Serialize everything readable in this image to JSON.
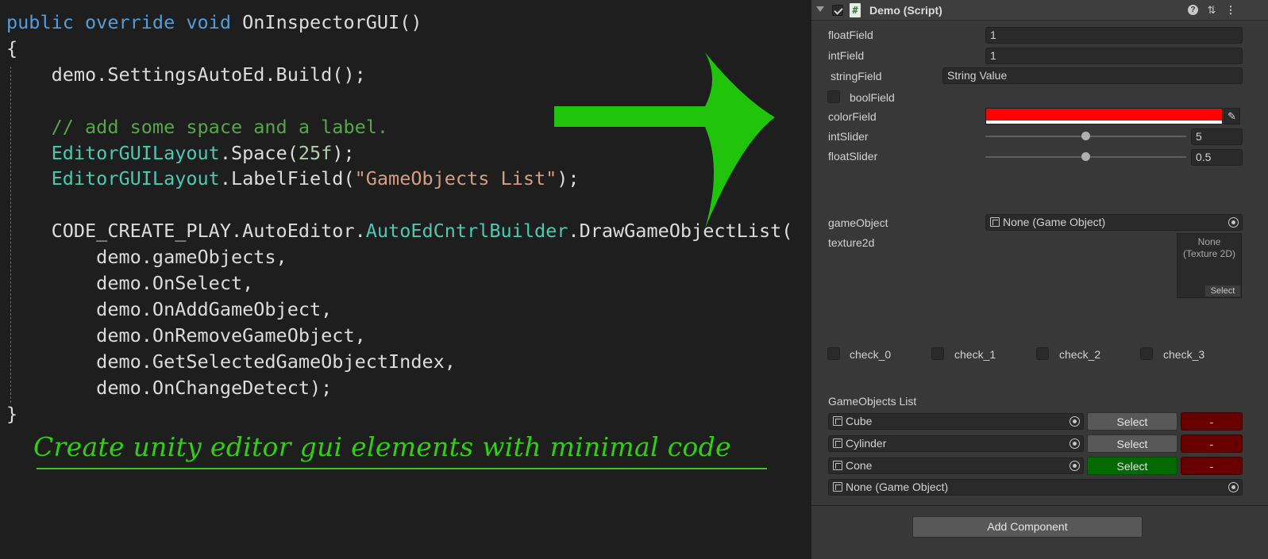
{
  "code": {
    "lines": [
      [
        {
          "t": "public override void ",
          "c": "kw"
        },
        {
          "t": "OnInspectorGUI()",
          "c": ""
        }
      ],
      [
        {
          "t": "{",
          "c": ""
        }
      ],
      [
        {
          "t": "    demo.SettingsAutoEd.Build();",
          "c": ""
        }
      ],
      [],
      [
        {
          "t": "    // add some space and a label.",
          "c": "cm"
        }
      ],
      [
        {
          "t": "    ",
          "c": ""
        },
        {
          "t": "EditorGUILayout",
          "c": "ty"
        },
        {
          "t": ".Space(",
          "c": ""
        },
        {
          "t": "25f",
          "c": "nm"
        },
        {
          "t": ");",
          "c": ""
        }
      ],
      [
        {
          "t": "    ",
          "c": ""
        },
        {
          "t": "EditorGUILayout",
          "c": "ty"
        },
        {
          "t": ".LabelField(",
          "c": ""
        },
        {
          "t": "\"GameObjects List\"",
          "c": "st"
        },
        {
          "t": ");",
          "c": ""
        }
      ],
      [],
      [
        {
          "t": "    CODE_CREATE_PLAY.AutoEditor.",
          "c": ""
        },
        {
          "t": "AutoEdCntrlBuilder",
          "c": "ty"
        },
        {
          "t": ".DrawGameObjectList(",
          "c": ""
        }
      ],
      [
        {
          "t": "        demo.gameObjects,",
          "c": ""
        }
      ],
      [
        {
          "t": "        demo.OnSelect,",
          "c": ""
        }
      ],
      [
        {
          "t": "        demo.OnAddGameObject,",
          "c": ""
        }
      ],
      [
        {
          "t": "        demo.OnRemoveGameObject,",
          "c": ""
        }
      ],
      [
        {
          "t": "        demo.GetSelectedGameObjectIndex,",
          "c": ""
        }
      ],
      [
        {
          "t": "        demo.OnChangeDetect);",
          "c": ""
        }
      ],
      [
        {
          "t": "}",
          "c": ""
        }
      ]
    ],
    "colors": {
      "kw": "#569cd6",
      "cm": "#57a64a",
      "ty": "#4ec9b0",
      "st": "#d69d85",
      "nm": "#b5cea8"
    }
  },
  "tagline": "Create unity editor gui elements with minimal code",
  "arrow": {
    "color": "#1fc40b"
  },
  "inspector": {
    "title": "Demo (Script)",
    "header_icons": [
      "help-icon",
      "preset-icon",
      "more-icon"
    ],
    "header_icon_glyphs": {
      "help": "?",
      "preset": "⇅",
      "more": "⋮"
    },
    "float_field": {
      "label": "floatField",
      "value": "1"
    },
    "int_field": {
      "label": "intField",
      "value": "1"
    },
    "string_field": {
      "label": "stringField",
      "value": "String Value"
    },
    "bool_field": {
      "label": "boolField",
      "checked": false
    },
    "color_field": {
      "label": "colorField",
      "value": "#ff0000"
    },
    "int_slider": {
      "label": "intSlider",
      "value": "5",
      "fraction": 0.5
    },
    "float_slider": {
      "label": "floatSlider",
      "value": "0.5",
      "fraction": 0.5
    },
    "game_object": {
      "label": "gameObject",
      "value": "None (Game Object)"
    },
    "texture2d": {
      "label": "texture2d",
      "value_line1": "None",
      "value_line2": "(Texture 2D)",
      "select_label": "Select"
    },
    "checks": [
      {
        "label": "check_0",
        "checked": false
      },
      {
        "label": "check_1",
        "checked": false
      },
      {
        "label": "check_2",
        "checked": false
      },
      {
        "label": "check_3",
        "checked": false
      }
    ],
    "gameobjects_list": {
      "label": "GameObjects List",
      "items": [
        {
          "name": "Cube",
          "select_label": "Select",
          "remove_label": "-",
          "selected": false
        },
        {
          "name": "Cylinder",
          "select_label": "Select",
          "remove_label": "-",
          "selected": false
        },
        {
          "name": "Cone",
          "select_label": "Select",
          "remove_label": "-",
          "selected": true
        }
      ],
      "add_slot": "None (Game Object)"
    },
    "add_component_label": "Add Component"
  }
}
